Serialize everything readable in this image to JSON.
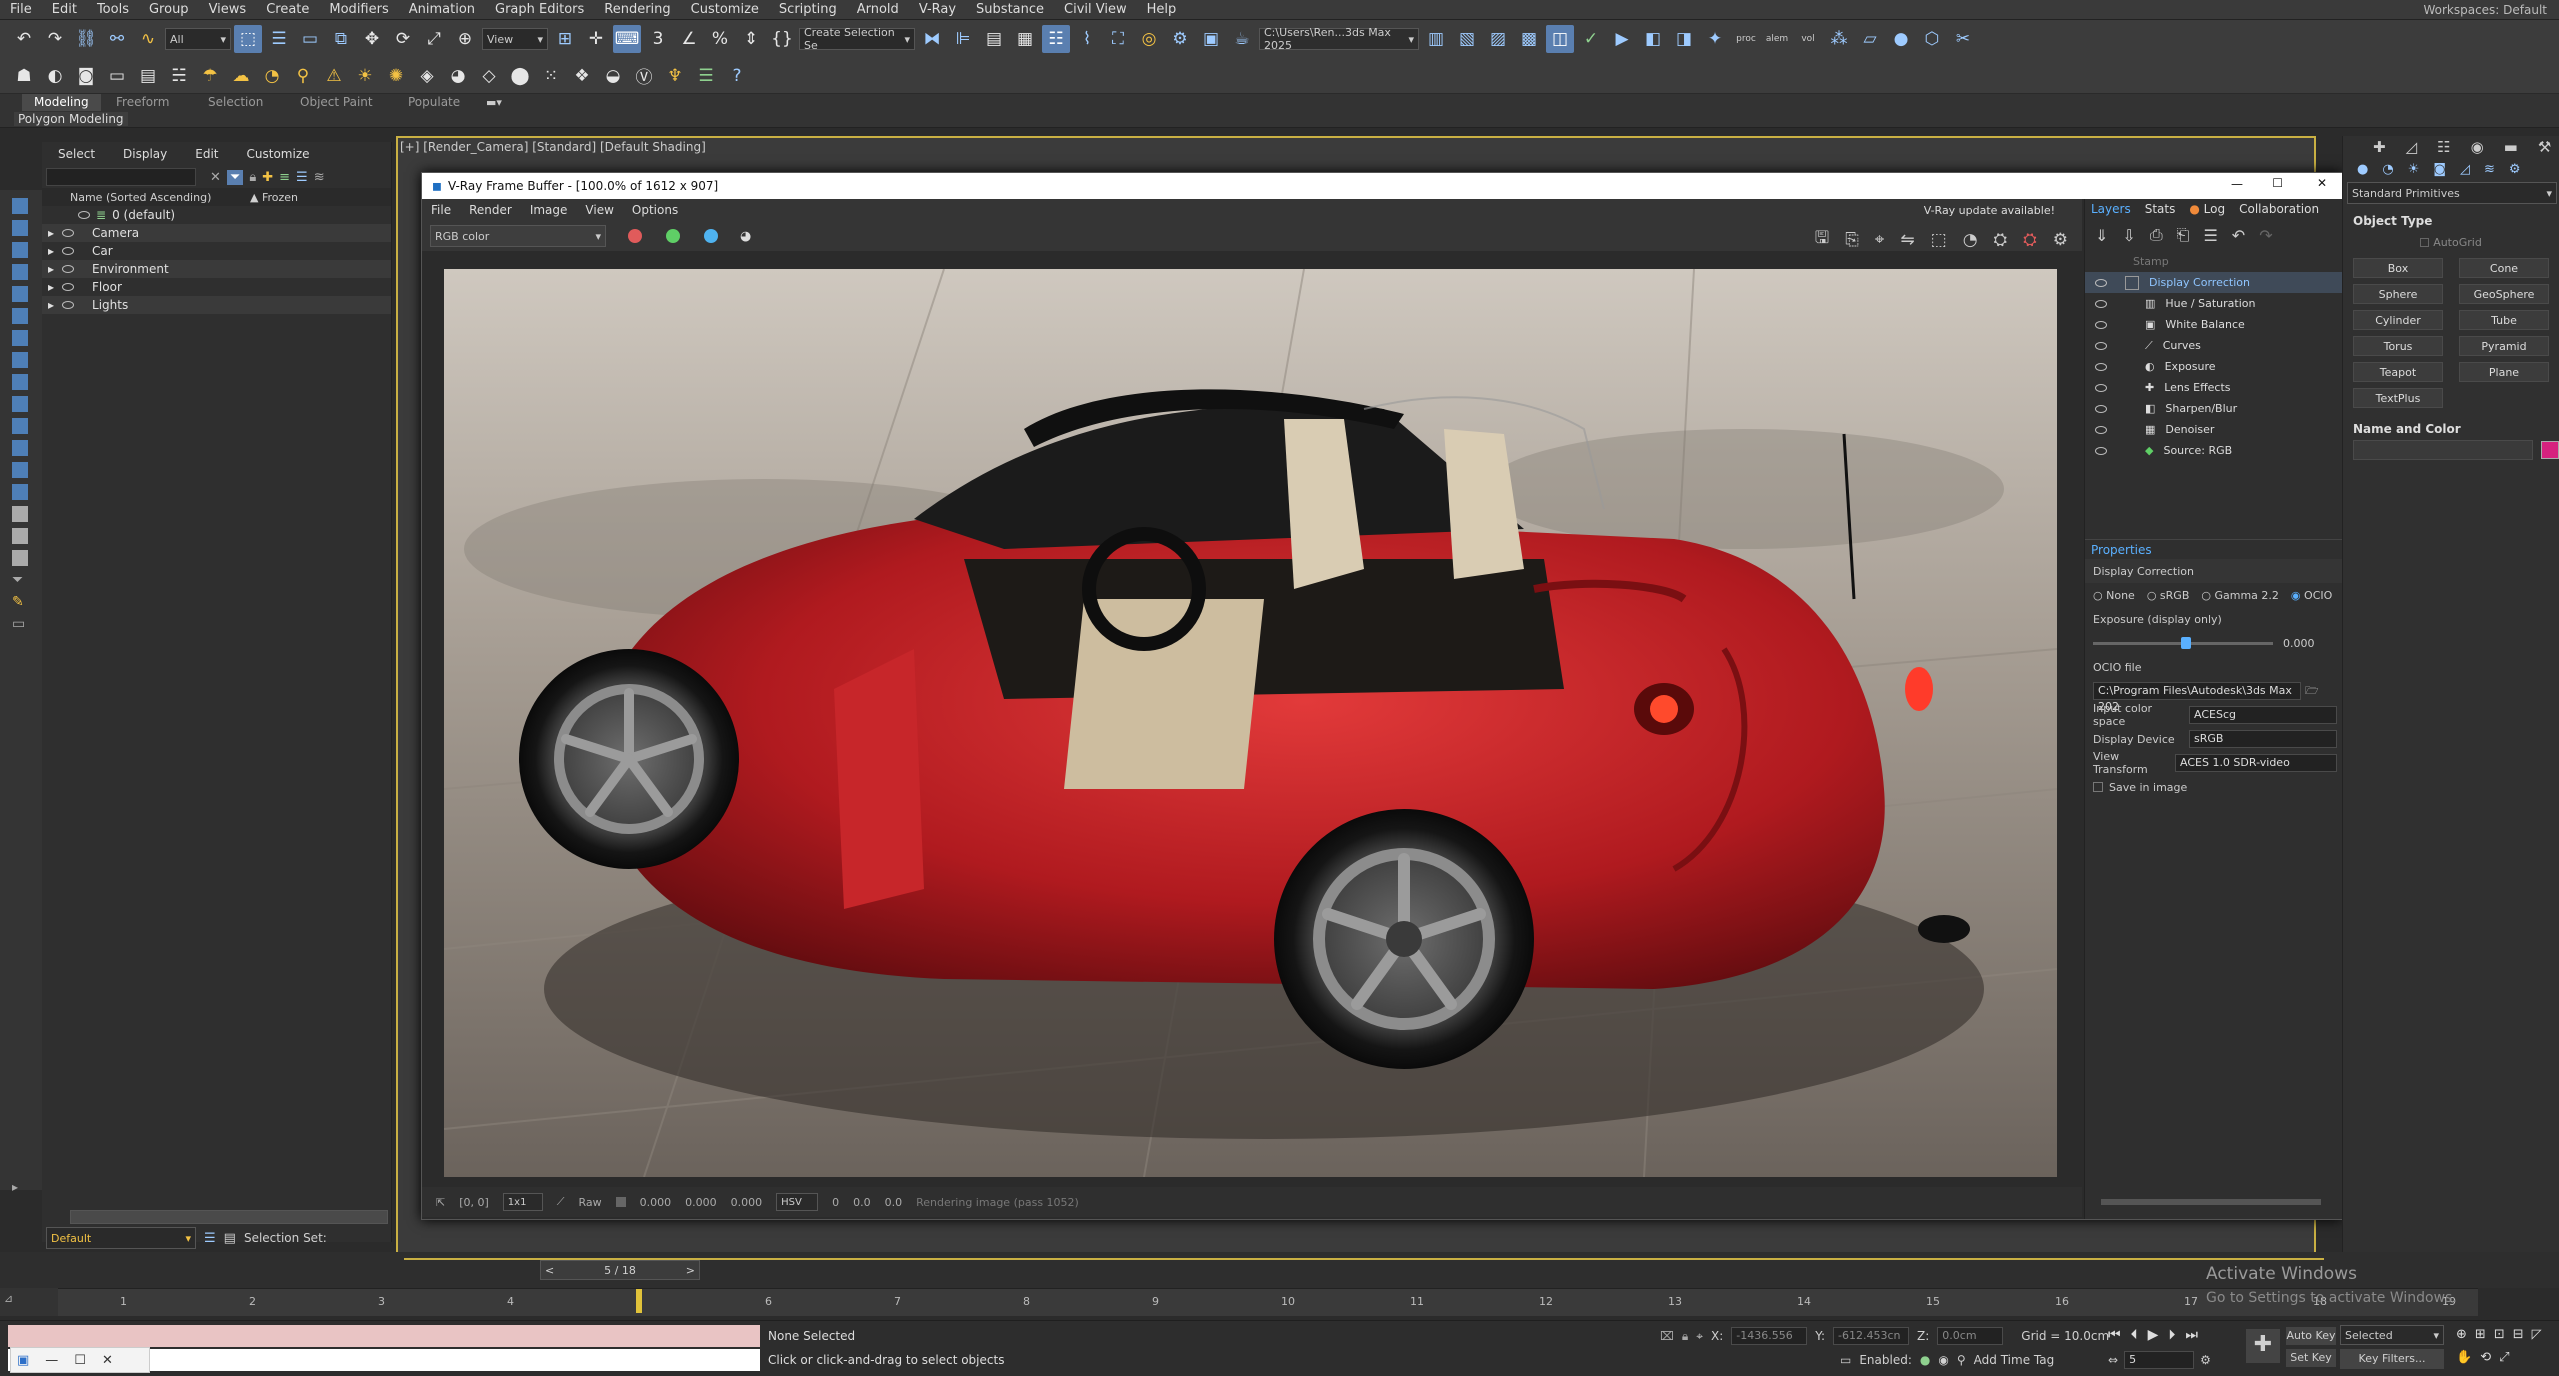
{
  "menu": [
    "File",
    "Edit",
    "Tools",
    "Group",
    "Views",
    "Create",
    "Modifiers",
    "Animation",
    "Graph Editors",
    "Rendering",
    "Customize",
    "Scripting",
    "Arnold",
    "V-Ray",
    "Substance",
    "Civil View",
    "Help"
  ],
  "workspaces": "Workspaces: Default",
  "toolbar": {
    "filter": "All",
    "coord": "View",
    "selection_set": "Create Selection Se",
    "project_path": "C:\\Users\\Ren...3ds Max 2025",
    "proc_label": "proc",
    "alem_label": "alem",
    "vol_label": "vol"
  },
  "ribbon": {
    "tabs": [
      "Modeling",
      "Freeform",
      "Selection",
      "Object Paint",
      "Populate"
    ],
    "active_sub": "Polygon Modeling"
  },
  "scene_explorer": {
    "menu": [
      "Select",
      "Display",
      "Edit",
      "Customize"
    ],
    "col_name": "Name (Sorted Ascending)",
    "col_frozen": "▲ Frozen",
    "rows": [
      "0 (default)",
      "Camera",
      "Car",
      "Environment",
      "Floor",
      "Lights"
    ],
    "layer_dropdown": "Default",
    "selection_set_label": "Selection Set:"
  },
  "viewport_label": "[+] [Render_Camera] [Standard] [Default Shading]",
  "vfb": {
    "title": "V-Ray Frame Buffer - [100.0% of 1612 x 907]",
    "menu": [
      "File",
      "Render",
      "Image",
      "View",
      "Options"
    ],
    "update": "V-Ray update available!",
    "channel": "RGB color",
    "status": {
      "coords": "[0, 0]",
      "ratio": "1x1",
      "raw": "Raw",
      "v1": "0.000",
      "v2": "0.000",
      "v3": "0.000",
      "mode": "HSV",
      "h": "0",
      "s": "0.0",
      "v": "0.0",
      "message": "Rendering image (pass 1052)"
    }
  },
  "layers_panel": {
    "tabs": [
      "Layers",
      "Stats",
      "Log",
      "Collaboration"
    ],
    "items": [
      "Stamp",
      "Display Correction",
      "Hue / Saturation",
      "White Balance",
      "Curves",
      "Exposure",
      "Lens Effects",
      "Sharpen/Blur",
      "Denoiser",
      "Source: RGB"
    ],
    "properties_title": "Properties",
    "prop_section": "Display Correction",
    "modes": [
      "None",
      "sRGB",
      "Gamma 2.2",
      "OCIO"
    ],
    "exposure_label": "Exposure (display only)",
    "exposure_value": "0.000",
    "ocio_label": "OCIO file",
    "ocio_path": "C:\\Program Files\\Autodesk\\3ds Max 202",
    "input_cs_label": "Input color space",
    "input_cs": "ACEScg",
    "device_label": "Display Device",
    "device": "sRGB",
    "view_label": "View Transform",
    "view": "ACES 1.0 SDR-video",
    "save_label": "Save in image"
  },
  "command_panel": {
    "dropdown": "Standard Primitives",
    "object_type": "Object Type",
    "autogrid": "AutoGrid",
    "buttons": [
      "Box",
      "Cone",
      "Sphere",
      "GeoSphere",
      "Cylinder",
      "Tube",
      "Torus",
      "Pyramid",
      "Teapot",
      "Plane",
      "TextPlus"
    ],
    "name_color": "Name and Color",
    "swatch_color": "#d6217e"
  },
  "timeline": {
    "frame": "5 / 18",
    "ticks": [
      "1",
      "2",
      "3",
      "4",
      "5",
      "6",
      "7",
      "8",
      "9",
      "10",
      "11",
      "12",
      "13",
      "14",
      "15",
      "16",
      "17",
      "18",
      "19"
    ]
  },
  "status": {
    "selected": "None Selected",
    "hint": "Click or click-and-drag to select objects",
    "x_label": "X:",
    "x": "-1436.556",
    "y_label": "Y:",
    "y": "-612.453cn",
    "z_label": "Z:",
    "z": "0.0cm",
    "grid": "Grid = 10.0cm",
    "enabled": "Enabled:",
    "add_time_tag": "Add Time Tag",
    "auto_key": "Auto Key",
    "set_key": "Set Key",
    "key_mode": "Selected",
    "key_filters": "Key Filters...",
    "frame_input": "5"
  },
  "watermark": {
    "line1": "Activate Windows",
    "line2": "Go to Settings to activate Windows."
  }
}
